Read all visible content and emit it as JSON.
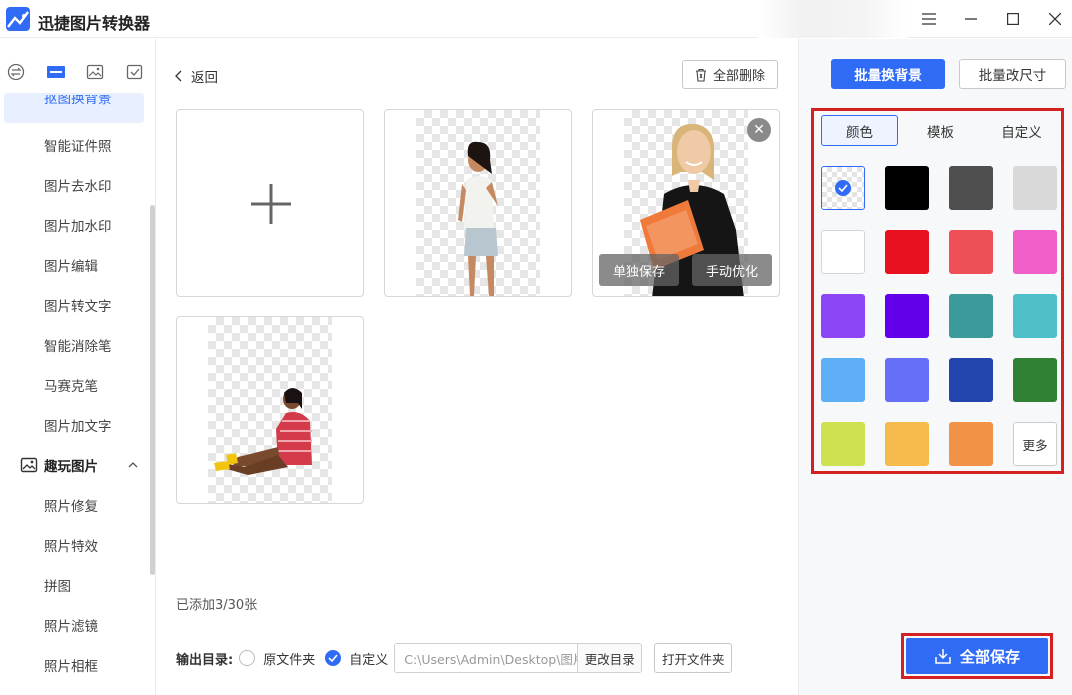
{
  "app": {
    "title": "迅捷图片转换器"
  },
  "sidebar": {
    "partial_item": "抠图换背景",
    "items": [
      "智能证件照",
      "图片去水印",
      "图片加水印",
      "图片编辑",
      "图片转文字",
      "智能消除笔",
      "马赛克笔",
      "图片加文字"
    ],
    "section": "趣玩图片",
    "section_items": [
      "照片修复",
      "照片特效",
      "拼图",
      "照片滤镜",
      "照片相框"
    ]
  },
  "main": {
    "back_label": "返回",
    "delete_all_label": "全部删除",
    "save_single_label": "单独保存",
    "manual_optimize_label": "手动优化",
    "count_text": "已添加3/30张",
    "output": {
      "label": "输出目录:",
      "option_original": "原文件夹",
      "option_custom": "自定义",
      "path": "C:\\Users\\Admin\\Desktop\\图片转换器",
      "change_dir_label": "更改目录",
      "open_folder_label": "打开文件夹"
    }
  },
  "right": {
    "batch_bg_label": "批量换背景",
    "batch_resize_label": "批量改尺寸",
    "tabs": [
      "颜色",
      "模板",
      "自定义"
    ],
    "colors": [
      "transparent",
      "#000000",
      "#4f4f4f",
      "#d9d9d9",
      "#ffffff",
      "#e8111f",
      "#ef4f56",
      "#f05ec7",
      "#8d46f5",
      "#6200ea",
      "#3d9a9a",
      "#4fc0c9",
      "#5faff7",
      "#6370f7",
      "#2144ad",
      "#2f8133",
      "#cfe050",
      "#f5bb4f",
      "#f29247"
    ],
    "more_label": "更多",
    "save_all_label": "全部保存"
  }
}
